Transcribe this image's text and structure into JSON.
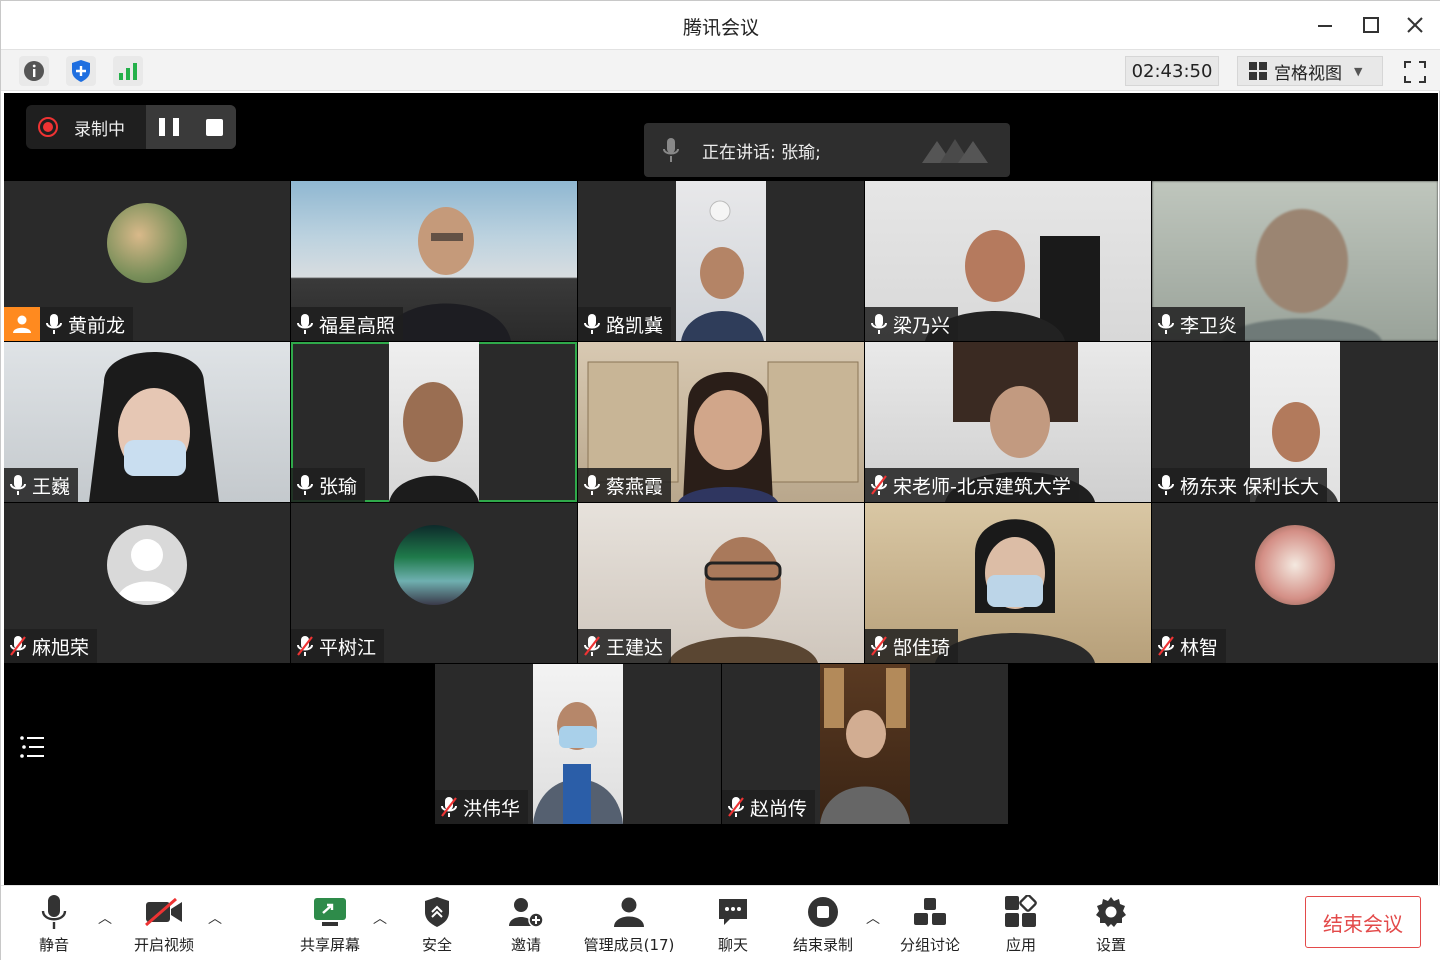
{
  "window": {
    "title": "腾讯会议"
  },
  "infobar": {
    "timer": "02:43:50",
    "view_label": "宫格视图"
  },
  "recording": {
    "label": "录制中"
  },
  "speaking": {
    "text": "正在讲话: 张瑜;"
  },
  "participants": [
    {
      "name": "黄前龙",
      "mic": "on",
      "host": true
    },
    {
      "name": "福星高照",
      "mic": "on"
    },
    {
      "name": "路凯冀",
      "mic": "on"
    },
    {
      "name": "梁乃兴",
      "mic": "on"
    },
    {
      "name": "李卫炎",
      "mic": "on"
    },
    {
      "name": "王巍",
      "mic": "on"
    },
    {
      "name": "张瑜",
      "mic": "on",
      "speaking": true
    },
    {
      "name": "蔡燕霞",
      "mic": "on"
    },
    {
      "name": "宋老师-北京建筑大学",
      "mic": "muted"
    },
    {
      "name": "杨东来 保利长大",
      "mic": "on"
    },
    {
      "name": "麻旭荣",
      "mic": "muted"
    },
    {
      "name": "平树江",
      "mic": "muted"
    },
    {
      "name": "王建达",
      "mic": "muted"
    },
    {
      "name": "郜佳琦",
      "mic": "muted"
    },
    {
      "name": "林智",
      "mic": "muted"
    },
    {
      "name": "洪伟华",
      "mic": "muted"
    },
    {
      "name": "赵尚传",
      "mic": "muted"
    }
  ],
  "toolbar": {
    "mute": "静音",
    "video": "开启视频",
    "share": "共享屏幕",
    "security": "安全",
    "invite": "邀请",
    "members": "管理成员(17)",
    "chat": "聊天",
    "end_record": "结束录制",
    "breakout": "分组讨论",
    "apps": "应用",
    "settings": "设置",
    "end_meeting": "结束会议"
  },
  "colors": {
    "accent_green": "#2fa94a",
    "end_red": "#e34a4a",
    "host_orange": "#ff8a1f",
    "record_red": "#ee3333"
  }
}
